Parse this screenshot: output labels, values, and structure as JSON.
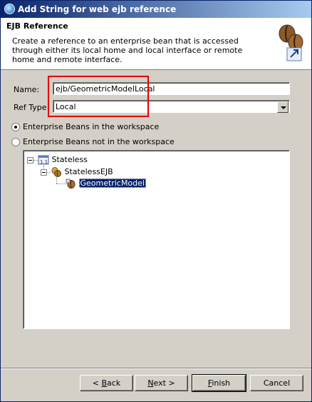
{
  "window": {
    "title": "Add String for web ejb reference"
  },
  "banner": {
    "title": "EJB Reference",
    "description": "Create a reference to an enterprise bean that is accessed through either its local home and local interface or remote home and remote interface.",
    "icon": "coffee-bean-wizard-icon"
  },
  "form": {
    "name_label": "Name:",
    "name_value": "ejb/GeometricModelLocal",
    "reftype_label": "Ref Type",
    "reftype_value": "Local"
  },
  "options": {
    "in_workspace": {
      "label": "Enterprise Beans in the workspace",
      "selected": true
    },
    "not_in_workspace": {
      "label": "Enterprise Beans not in the workspace",
      "selected": false
    }
  },
  "tree": {
    "root": {
      "label": "Stateless",
      "icon": "ejb-project-icon"
    },
    "child": {
      "label": "StatelessEJB",
      "icon": "ejb-module-icon"
    },
    "leaf": {
      "label": "GeometricModel",
      "icon": "session-bean-icon",
      "selected": true
    }
  },
  "buttons": {
    "back": {
      "pre": "< ",
      "mn": "B",
      "post": "ack"
    },
    "next": {
      "pre": "",
      "mn": "N",
      "post": "ext >"
    },
    "finish": {
      "pre": "",
      "mn": "F",
      "post": "inish"
    },
    "cancel": {
      "label": "Cancel"
    }
  }
}
